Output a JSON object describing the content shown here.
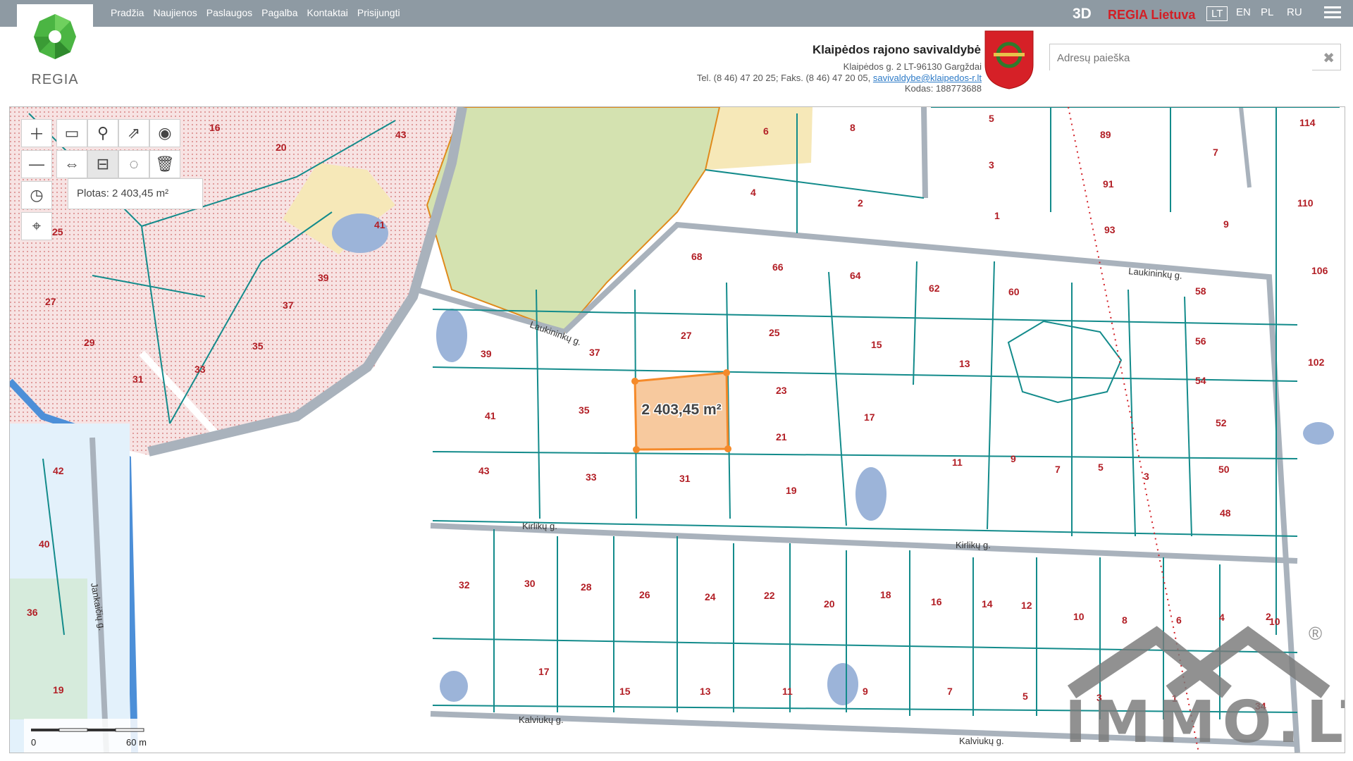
{
  "nav": {
    "items": [
      "Pradžia",
      "Naujienos",
      "Paslaugos",
      "Pagalba",
      "Kontaktai",
      "Prisijungti"
    ]
  },
  "brand": {
    "logo_text": "REGIA",
    "mode_3d": "3D",
    "regia_lietuva": "REGIA Lietuva"
  },
  "languages": [
    {
      "code": "LT",
      "active": true
    },
    {
      "code": "EN",
      "active": false
    },
    {
      "code": "PL",
      "active": false
    },
    {
      "code": "RU",
      "active": false
    }
  ],
  "municipality": {
    "name": "Klaipėdos rajono savivaldybė",
    "address": "Klaipėdos g. 2 LT-96130 Gargždai",
    "phone": "Tel. (8 46) 47 20 25; Faks. (8 46) 47 20 05,",
    "email": "savivaldybe@klaipedos-r.lt",
    "code": "Kodas: 188773688"
  },
  "search": {
    "placeholder": "Adresų paieška",
    "value": ""
  },
  "map_tools": {
    "measure_result": "Plotas: 2 403,45 m²",
    "area_label": "2 403,45 m²",
    "scale_start": "0",
    "scale_end": "60 m"
  },
  "streets": [
    "Laukininkų g.",
    "Laukininkų g.",
    "Kirlikų g.",
    "Kirlikų g.",
    "Kalviukų g.",
    "Kalviukų g.",
    "Jankaičių g."
  ],
  "watermark": {
    "text": "IMMO.LT",
    "registered": "®"
  },
  "parcels": [
    "16",
    "20",
    "43",
    "8",
    "6",
    "5",
    "3",
    "1",
    "89",
    "91",
    "93",
    "114",
    "7",
    "110",
    "9",
    "106",
    "4",
    "2",
    "41",
    "25",
    "39",
    "37",
    "27",
    "29",
    "31",
    "33",
    "35",
    "68",
    "66",
    "64",
    "62",
    "60",
    "58",
    "56",
    "54",
    "52",
    "50",
    "48",
    "102",
    "39",
    "37",
    "27",
    "25",
    "15",
    "13",
    "41",
    "35",
    "23",
    "21",
    "17",
    "11",
    "9",
    "7",
    "5",
    "3",
    "43",
    "33",
    "31",
    "19",
    "42",
    "40",
    "32",
    "30",
    "28",
    "26",
    "24",
    "22",
    "20",
    "18",
    "16",
    "14",
    "12",
    "10",
    "8",
    "6",
    "4",
    "2",
    "10",
    "36",
    "19",
    "17",
    "15",
    "13",
    "11",
    "9",
    "7",
    "5",
    "3",
    "1",
    "34"
  ]
}
